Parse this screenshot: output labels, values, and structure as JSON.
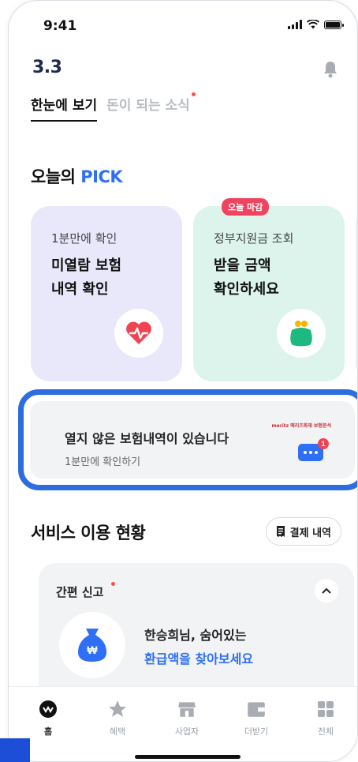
{
  "status_bar": {
    "time": "9:41"
  },
  "header": {
    "logo": "3.3"
  },
  "tabs": [
    {
      "label": "한눈에 보기",
      "active": true
    },
    {
      "label": "돈이 되는 소식",
      "active": false,
      "has_dot": true
    }
  ],
  "today_pick": {
    "title_prefix": "오늘의",
    "title_accent": "PICK"
  },
  "pick_cards": [
    {
      "sub": "1분만에 확인",
      "title": "미열람 보험\n내역 확인",
      "icon": "heart-pulse-icon"
    },
    {
      "sub": "정부지원금 조회",
      "title": "받을 금액\n확인하세요",
      "icon": "purse-icon",
      "badge": "오늘 마감"
    }
  ],
  "banner": {
    "title": "열지 않은 보험내역이 있습니다",
    "subtitle": "1분만에 확인하기",
    "brand": "meritz 메리츠화재 보험분석",
    "notification_count": "1"
  },
  "services": {
    "title": "서비스 이용 현황",
    "payment_button": "결제 내역"
  },
  "simple_report": {
    "label": "간편 신고",
    "line1": "한승희님, 숨어있는",
    "line2": "환급액을 찾아보세요"
  },
  "bottom_nav": [
    {
      "label": "홈",
      "icon": "home-icon",
      "active": true
    },
    {
      "label": "혜택",
      "icon": "star-icon",
      "active": false
    },
    {
      "label": "사업자",
      "icon": "store-icon",
      "active": false
    },
    {
      "label": "더받기",
      "icon": "wallet-icon",
      "active": false
    },
    {
      "label": "전체",
      "icon": "grid-icon",
      "active": false
    }
  ],
  "colors": {
    "accent_blue": "#2f6ff5",
    "highlight_border": "#2d6de0",
    "badge_red": "#f0435f",
    "card_lavender": "#e9e8fb",
    "card_mint": "#dcf4ec"
  }
}
